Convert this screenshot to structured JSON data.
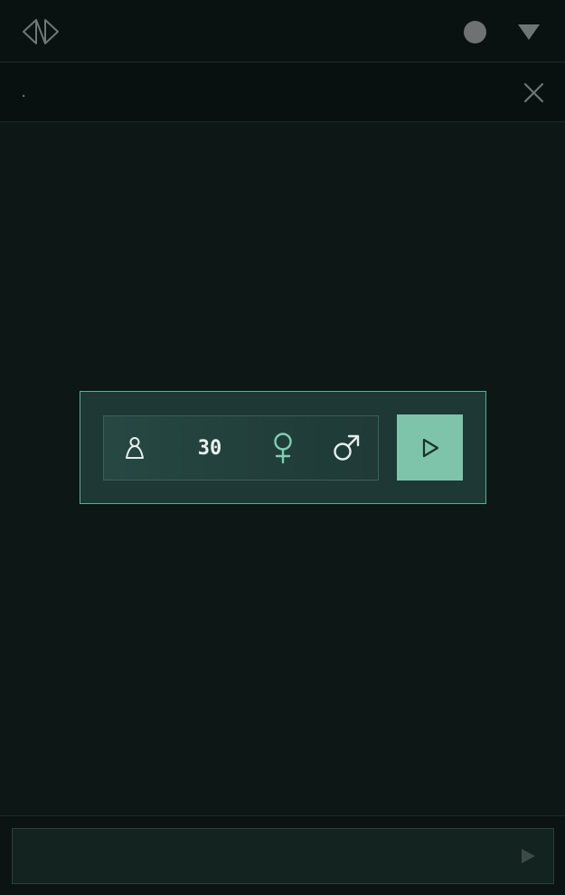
{
  "header": {
    "logo_icon": "double-chevron-diamond-logo",
    "status_icon": "status-dot",
    "status_color": "#6e7272",
    "menu_icon": "triangle-down-icon"
  },
  "subbar": {
    "text": ".",
    "close_icon": "close-icon"
  },
  "panel": {
    "person_icon": "person-icon",
    "count": "30",
    "female_icon": "female-symbol-icon",
    "male_icon": "male-symbol-icon",
    "play_icon": "play-icon",
    "accent_color": "#7dc4aa",
    "border_color": "#57b195"
  },
  "footer": {
    "message_value": "",
    "send_icon": "send-triangle-icon"
  }
}
